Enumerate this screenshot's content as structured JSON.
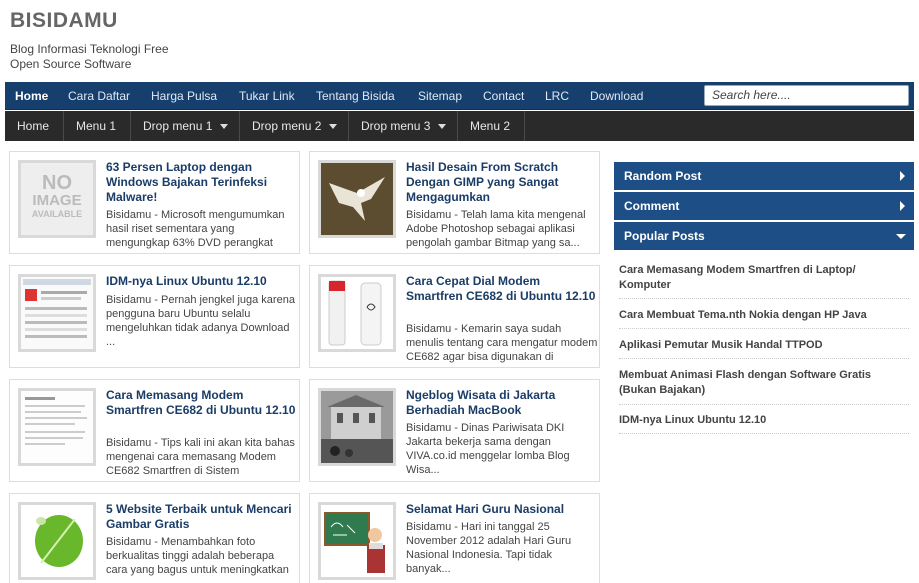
{
  "site": {
    "title": "BISIDAMU",
    "description": "Blog Informasi Teknologi Free Open Source Software"
  },
  "nav_primary": [
    "Home",
    "Cara Daftar",
    "Harga Pulsa",
    "Tukar Link",
    "Tentang Bisida",
    "Sitemap",
    "Contact",
    "LRC",
    "Download"
  ],
  "search": {
    "placeholder": "Search here...."
  },
  "nav_secondary": [
    "Home",
    "Menu 1",
    "Drop menu 1",
    "Drop menu 2",
    "Drop menu 3",
    "Menu 2"
  ],
  "posts": [
    {
      "title": "63 Persen Laptop dengan Windows Bajakan Terinfeksi Malware!",
      "excerpt": "Bisidamu - Microsoft mengumumkan hasil riset sementara yang mengungkap 63% DVD perangkat",
      "thumb": "no-image"
    },
    {
      "title": "Hasil Desain From Scratch Dengan GIMP yang Sangat Mengagumkan",
      "excerpt": "Bisidamu - Telah lama kita mengenal Adobe Photoshop sebagai aplikasi pengolah gambar Bitmap yang sa...",
      "thumb": "eagle"
    },
    {
      "title": "IDM-nya Linux Ubuntu 12.10",
      "excerpt": "Bisidamu - Pernah jengkel juga karena pengguna baru Ubuntu selalu mengeluhkan tidak adanya Download ...",
      "thumb": "screenshot"
    },
    {
      "title": "Cara Cepat Dial Modem Smartfren CE682 di Ubuntu 12.10",
      "excerpt": "Bisidamu - Kemarin saya sudah menulis tentang cara mengatur modem CE682 agar bisa digunakan di",
      "thumb": "modem"
    },
    {
      "title": "Cara Memasang Modem Smartfren CE682 di Ubuntu 12.10",
      "excerpt": "Bisidamu - Tips kali ini akan kita bahas mengenai cara memasang Modem CE682 Smartfren di Sistem",
      "thumb": "document"
    },
    {
      "title": "Ngeblog Wisata di Jakarta Berhadiah MacBook",
      "excerpt": "Bisidamu - Dinas Pariwisata DKI Jakarta bekerja sama dengan VIVA.co.id menggelar lomba Blog Wisa...",
      "thumb": "building"
    },
    {
      "title": "5 Website Terbaik untuk Mencari Gambar Gratis",
      "excerpt": "Bisidamu - Menambahkan foto berkualitas tinggi adalah beberapa cara yang bagus untuk meningkatkan",
      "thumb": "leaf"
    },
    {
      "title": "Selamat Hari Guru Nasional",
      "excerpt": "Bisidamu - Hari ini tanggal 25 November 2012 adalah Hari Guru Nasional Indonesia. Tapi tidak banyak...",
      "thumb": "teacher"
    }
  ],
  "sidebar": {
    "tabs": [
      "Random Post",
      "Comment",
      "Popular Posts"
    ],
    "popular": [
      "Cara Memasang Modem Smartfren di Laptop/ Komputer",
      "Cara Membuat Tema.nth Nokia dengan HP Java",
      "Aplikasi Pemutar Musik Handal TTPOD",
      "Membuat Animasi Flash dengan Software Gratis (Bukan Bajakan)",
      "IDM-nya Linux Ubuntu 12.10"
    ]
  },
  "thumb_text": {
    "no_image_line1": "NO",
    "no_image_line2": "IMAGE",
    "no_image_line3": "AVAILABLE"
  },
  "colors": {
    "nav_primary_bg": "#163f6e",
    "nav_secondary_bg": "#2a2a2a",
    "sidebar_tab_bg": "#1d4f86",
    "post_title": "#1a3c66"
  }
}
